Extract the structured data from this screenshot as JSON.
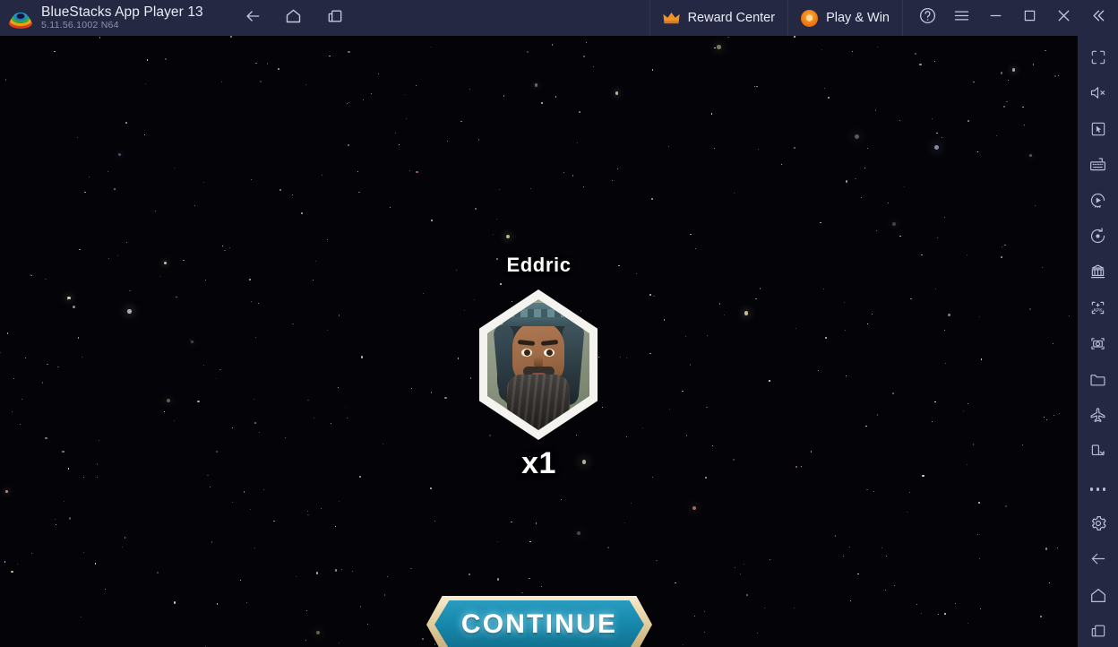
{
  "window": {
    "app_title": "BlueStacks App Player 13",
    "version": "5.11.56.1002  N64",
    "logo_icon": "bluestacks-logo"
  },
  "titlebar": {
    "nav": [
      {
        "name": "back-button",
        "icon": "arrow-left-icon",
        "label": "Back"
      },
      {
        "name": "home-button",
        "icon": "home-icon",
        "label": "Home"
      },
      {
        "name": "recents-button",
        "icon": "multi-window-icon",
        "label": "Recents"
      }
    ],
    "reward_center": {
      "label": "Reward Center",
      "icon": "crown-icon"
    },
    "play_and_win": {
      "label": "Play & Win",
      "icon": "coin-icon"
    },
    "controls": [
      {
        "name": "help-button",
        "icon": "question-circle-icon",
        "label": "Help"
      },
      {
        "name": "menu-button",
        "icon": "hamburger-menu-icon",
        "label": "Menu"
      },
      {
        "name": "minimize-button",
        "icon": "minimize-icon",
        "label": "Minimize"
      },
      {
        "name": "maximize-button",
        "icon": "maximize-icon",
        "label": "Maximize"
      },
      {
        "name": "close-button",
        "icon": "close-icon",
        "label": "Close"
      },
      {
        "name": "collapse-sidebar-button",
        "icon": "chevron-double-left-icon",
        "label": "Collapse"
      }
    ]
  },
  "sidebar": {
    "items": [
      {
        "name": "fullscreen-button",
        "icon": "fullscreen-icon",
        "label": "Full screen"
      },
      {
        "name": "mute-button",
        "icon": "speaker-mute-icon",
        "label": "Mute"
      },
      {
        "name": "game-controls-button",
        "icon": "cursor-box-icon",
        "label": "Game controls"
      },
      {
        "name": "keyboard-controls-button",
        "icon": "keyboard-icon",
        "label": "Keyboard controls"
      },
      {
        "name": "macro-button",
        "icon": "macro-play-icon",
        "label": "Macros"
      },
      {
        "name": "sync-operations-button",
        "icon": "sync-rotate-icon",
        "label": "Sync operations"
      },
      {
        "name": "multi-instance-button",
        "icon": "multi-instance-icon",
        "label": "Multi-instance manager"
      },
      {
        "name": "install-apk-button",
        "icon": "apk-install-icon",
        "label": "Install APK"
      },
      {
        "name": "screenshot-button",
        "icon": "camera-icon",
        "label": "Screenshot"
      },
      {
        "name": "media-manager-button",
        "icon": "folder-icon",
        "label": "Media manager"
      },
      {
        "name": "eco-mode-button",
        "icon": "airplane-icon",
        "label": "Eco mode"
      },
      {
        "name": "rotate-screen-button",
        "icon": "rotate-screen-icon",
        "label": "Rotate"
      },
      {
        "name": "more-options-button",
        "icon": "ellipsis-icon",
        "label": "More"
      },
      {
        "name": "settings-button",
        "icon": "gear-icon",
        "label": "Settings"
      },
      {
        "name": "android-back-button",
        "icon": "arrow-left-icon",
        "label": "Back"
      },
      {
        "name": "android-home-button",
        "icon": "home-icon",
        "label": "Home"
      },
      {
        "name": "android-recents-button",
        "icon": "multi-window-icon",
        "label": "Recents"
      }
    ]
  },
  "game": {
    "character": {
      "name": "Eddric",
      "count": "x1",
      "portrait_icon": "character-portrait-eddric"
    },
    "continue_button": {
      "label": "CONTINUE"
    },
    "colors": {
      "background": "#030308",
      "button_fill": "#1789AD",
      "button_border": "#E4CF9F",
      "text": "#FFFFFF"
    }
  }
}
